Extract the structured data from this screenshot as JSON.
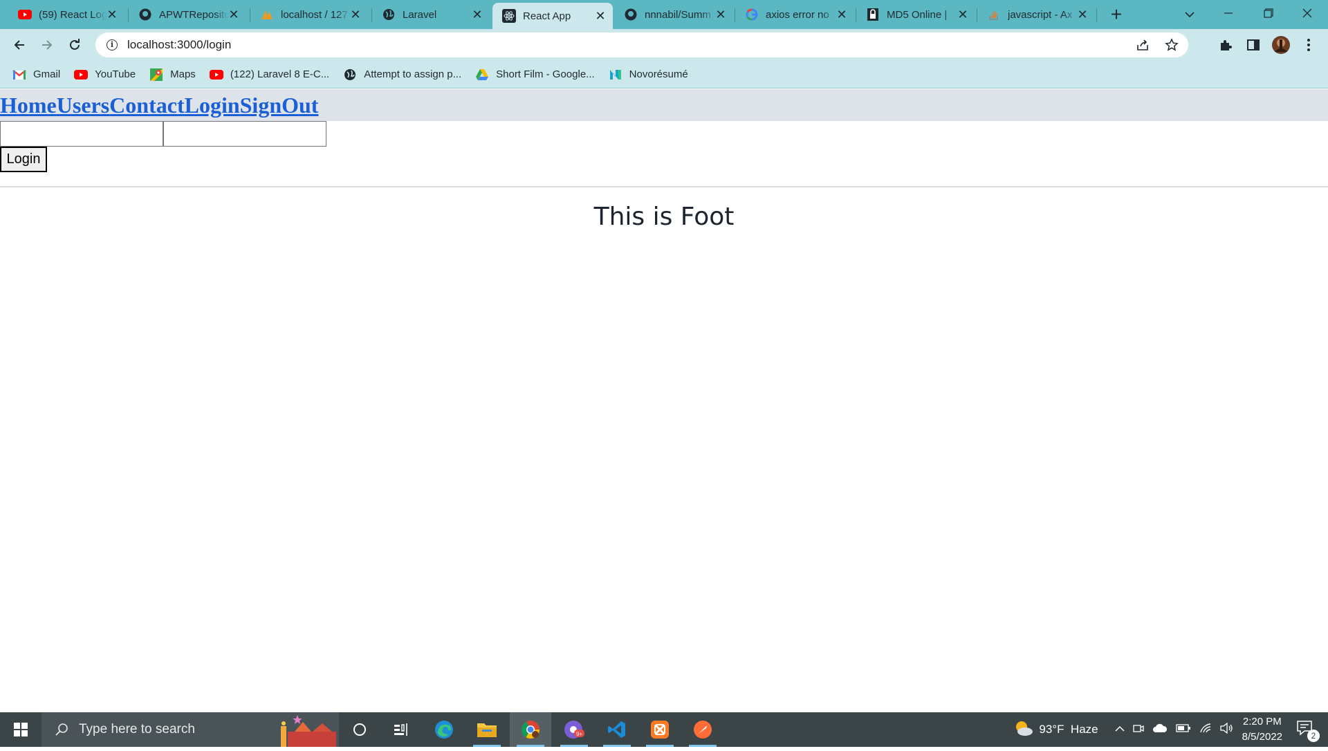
{
  "browser": {
    "tabs": [
      {
        "title": "(59) React Log",
        "favicon": "youtube-icon",
        "active": false
      },
      {
        "title": "APWTReposito",
        "favicon": "github-icon",
        "active": false
      },
      {
        "title": "localhost / 127",
        "favicon": "phpmyadmin-icon",
        "active": false
      },
      {
        "title": "Laravel",
        "favicon": "globe-icon",
        "active": false
      },
      {
        "title": "React App",
        "favicon": "react-icon",
        "active": true
      },
      {
        "title": "nnnabil/Summ",
        "favicon": "github-icon",
        "active": false
      },
      {
        "title": "axios error no",
        "favicon": "google-icon",
        "active": false
      },
      {
        "title": "MD5 Online |",
        "favicon": "lock-icon",
        "active": false
      },
      {
        "title": "javascript - Ax",
        "favicon": "stackoverflow-icon",
        "active": false
      }
    ],
    "url": "localhost:3000/login",
    "bookmarks": [
      {
        "label": "Gmail",
        "icon": "gmail-icon"
      },
      {
        "label": "YouTube",
        "icon": "youtube-icon"
      },
      {
        "label": "Maps",
        "icon": "maps-icon"
      },
      {
        "label": "(122) Laravel 8 E-C...",
        "icon": "youtube-icon"
      },
      {
        "label": "Attempt to assign p...",
        "icon": "globe-icon"
      },
      {
        "label": "Short Film - Google...",
        "icon": "drive-icon"
      },
      {
        "label": "Novorésumé",
        "icon": "novoresume-icon"
      }
    ]
  },
  "page": {
    "nav": {
      "home": "Home",
      "users": "Users",
      "contact": "Contact",
      "login": "Login",
      "signout": "SignOut"
    },
    "form": {
      "username_value": "",
      "password_value": "",
      "login_label": "Login"
    },
    "footer": "This is Foot"
  },
  "taskbar": {
    "search_placeholder": "Type here to search",
    "weather": "93°F  Haze",
    "time": "2:20 PM",
    "date": "8/5/2022",
    "notification_count": "2",
    "accent_color": "#7fc4e8"
  },
  "colors": {
    "tabstrip": "#5bb7c2",
    "toolbar": "#cde8ec",
    "link": "#1a5fd6",
    "navbar_bg": "#dee3ea"
  }
}
